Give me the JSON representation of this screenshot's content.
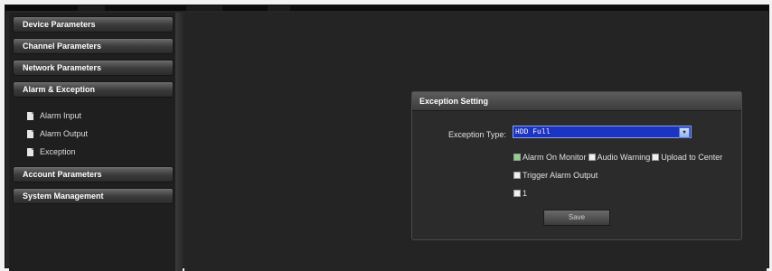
{
  "sidebar": {
    "sections_top": [
      {
        "label": "Device Parameters"
      },
      {
        "label": "Channel Parameters"
      },
      {
        "label": "Network Parameters"
      },
      {
        "label": "Alarm & Exception"
      }
    ],
    "alarm_items": [
      {
        "label": "Alarm Input",
        "icon": "document-icon"
      },
      {
        "label": "Alarm Output",
        "icon": "document-icon"
      },
      {
        "label": "Exception",
        "icon": "document-icon"
      }
    ],
    "sections_bottom": [
      {
        "label": "Account Parameters"
      },
      {
        "label": "System Management"
      }
    ]
  },
  "panel": {
    "title": "Exception Setting",
    "exception_type_label": "Exception Type:",
    "exception_type_value": "HDD Full",
    "options": {
      "alarm_on_monitor": {
        "label": "Alarm On Monitor",
        "checked": true
      },
      "audio_warning": {
        "label": "Audio Warning",
        "checked": false
      },
      "upload_to_center": {
        "label": "Upload to Center",
        "checked": false
      },
      "trigger_alarm_output": {
        "label": "Trigger Alarm Output",
        "checked": false
      },
      "output_1": {
        "label": "1",
        "checked": false
      }
    },
    "save_label": "Save"
  },
  "colors": {
    "background": "#262626",
    "select_highlight": "#1c34c2",
    "header_text": "#ffffff"
  }
}
